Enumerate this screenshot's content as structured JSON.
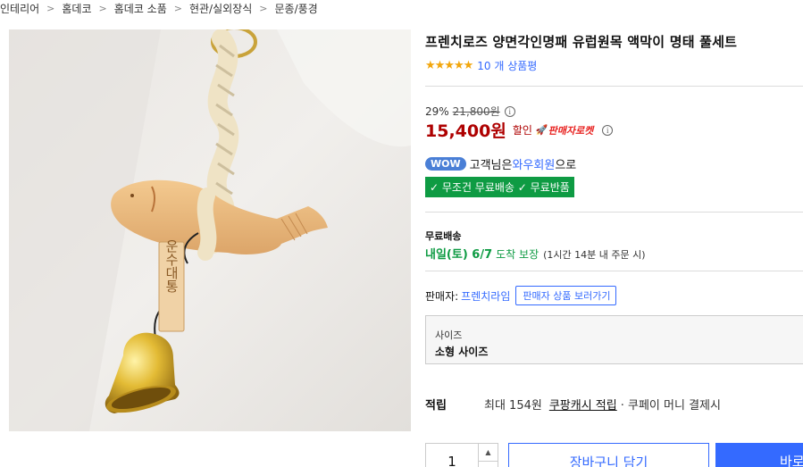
{
  "breadcrumb": [
    "인테리어",
    "홈데코",
    "홈데코 소품",
    "현관/실외장식",
    "문종/풍경"
  ],
  "product": {
    "title": "프렌치로즈 양면각인명패 유럽원목 액막이 명태 풀세트",
    "rating_stars": 5,
    "review_text": "10 개 상품평",
    "tag_text": "운수대통"
  },
  "price": {
    "discount_rate": "29%",
    "original": "21,800원",
    "sale": "15,400원",
    "sale_label": "할인",
    "rocket_label": "판매자로켓"
  },
  "wow": {
    "badge": "WOW",
    "text_pre": "고객님은 ",
    "member": "와우회원",
    "text_post": "으로",
    "free_shipping": "✓ 무조건 무료배송 ✓ 무료반품"
  },
  "shipping": {
    "label": "무료배송",
    "day": "내일(토) 6/7",
    "guarantee": "도착 보장",
    "condition": "(1시간 14분 내 주문 시)"
  },
  "seller": {
    "label": "판매자:",
    "name": "프렌치라임",
    "button": "판매자 상품 보러가기"
  },
  "option": {
    "label": "사이즈",
    "value": "소형 사이즈"
  },
  "reward": {
    "label": "적립",
    "text": "최대 154원",
    "link": "쿠팡캐시 적립",
    "rest": "· 쿠페이 머니 결제시"
  },
  "purchase": {
    "quantity": "1",
    "cart": "장바구니 담기",
    "buy": "바로"
  },
  "colors": {
    "accent": "#346aff",
    "sale": "#ae0000",
    "green": "#0e9b43",
    "star": "#f2a60c"
  }
}
